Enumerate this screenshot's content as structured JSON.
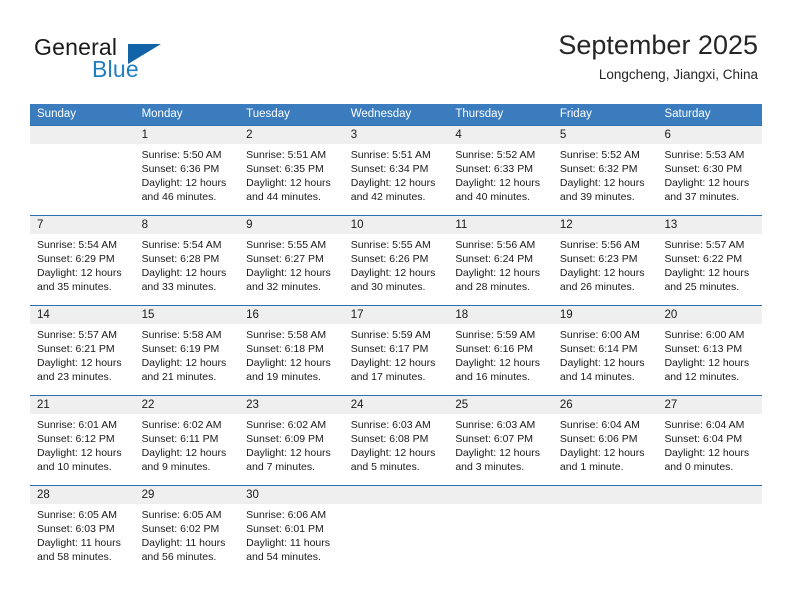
{
  "brand": {
    "word1": "General",
    "word2": "Blue",
    "accent": "#1f7fc4",
    "triangle_color": "#1263a8"
  },
  "header": {
    "title": "September 2025",
    "location": "Longcheng, Jiangxi, China",
    "header_bg": "#3a7cbe",
    "row_divider": "#2f6fad",
    "date_band_bg": "#efefef"
  },
  "weekdays": [
    "Sunday",
    "Monday",
    "Tuesday",
    "Wednesday",
    "Thursday",
    "Friday",
    "Saturday"
  ],
  "weeks": [
    {
      "days": [
        {
          "num": "",
          "l1": "",
          "l2": "",
          "l3": "",
          "l4": ""
        },
        {
          "num": "1",
          "l1": "Sunrise: 5:50 AM",
          "l2": "Sunset: 6:36 PM",
          "l3": "Daylight: 12 hours",
          "l4": "and 46 minutes."
        },
        {
          "num": "2",
          "l1": "Sunrise: 5:51 AM",
          "l2": "Sunset: 6:35 PM",
          "l3": "Daylight: 12 hours",
          "l4": "and 44 minutes."
        },
        {
          "num": "3",
          "l1": "Sunrise: 5:51 AM",
          "l2": "Sunset: 6:34 PM",
          "l3": "Daylight: 12 hours",
          "l4": "and 42 minutes."
        },
        {
          "num": "4",
          "l1": "Sunrise: 5:52 AM",
          "l2": "Sunset: 6:33 PM",
          "l3": "Daylight: 12 hours",
          "l4": "and 40 minutes."
        },
        {
          "num": "5",
          "l1": "Sunrise: 5:52 AM",
          "l2": "Sunset: 6:32 PM",
          "l3": "Daylight: 12 hours",
          "l4": "and 39 minutes."
        },
        {
          "num": "6",
          "l1": "Sunrise: 5:53 AM",
          "l2": "Sunset: 6:30 PM",
          "l3": "Daylight: 12 hours",
          "l4": "and 37 minutes."
        }
      ]
    },
    {
      "days": [
        {
          "num": "7",
          "l1": "Sunrise: 5:54 AM",
          "l2": "Sunset: 6:29 PM",
          "l3": "Daylight: 12 hours",
          "l4": "and 35 minutes."
        },
        {
          "num": "8",
          "l1": "Sunrise: 5:54 AM",
          "l2": "Sunset: 6:28 PM",
          "l3": "Daylight: 12 hours",
          "l4": "and 33 minutes."
        },
        {
          "num": "9",
          "l1": "Sunrise: 5:55 AM",
          "l2": "Sunset: 6:27 PM",
          "l3": "Daylight: 12 hours",
          "l4": "and 32 minutes."
        },
        {
          "num": "10",
          "l1": "Sunrise: 5:55 AM",
          "l2": "Sunset: 6:26 PM",
          "l3": "Daylight: 12 hours",
          "l4": "and 30 minutes."
        },
        {
          "num": "11",
          "l1": "Sunrise: 5:56 AM",
          "l2": "Sunset: 6:24 PM",
          "l3": "Daylight: 12 hours",
          "l4": "and 28 minutes."
        },
        {
          "num": "12",
          "l1": "Sunrise: 5:56 AM",
          "l2": "Sunset: 6:23 PM",
          "l3": "Daylight: 12 hours",
          "l4": "and 26 minutes."
        },
        {
          "num": "13",
          "l1": "Sunrise: 5:57 AM",
          "l2": "Sunset: 6:22 PM",
          "l3": "Daylight: 12 hours",
          "l4": "and 25 minutes."
        }
      ]
    },
    {
      "days": [
        {
          "num": "14",
          "l1": "Sunrise: 5:57 AM",
          "l2": "Sunset: 6:21 PM",
          "l3": "Daylight: 12 hours",
          "l4": "and 23 minutes."
        },
        {
          "num": "15",
          "l1": "Sunrise: 5:58 AM",
          "l2": "Sunset: 6:19 PM",
          "l3": "Daylight: 12 hours",
          "l4": "and 21 minutes."
        },
        {
          "num": "16",
          "l1": "Sunrise: 5:58 AM",
          "l2": "Sunset: 6:18 PM",
          "l3": "Daylight: 12 hours",
          "l4": "and 19 minutes."
        },
        {
          "num": "17",
          "l1": "Sunrise: 5:59 AM",
          "l2": "Sunset: 6:17 PM",
          "l3": "Daylight: 12 hours",
          "l4": "and 17 minutes."
        },
        {
          "num": "18",
          "l1": "Sunrise: 5:59 AM",
          "l2": "Sunset: 6:16 PM",
          "l3": "Daylight: 12 hours",
          "l4": "and 16 minutes."
        },
        {
          "num": "19",
          "l1": "Sunrise: 6:00 AM",
          "l2": "Sunset: 6:14 PM",
          "l3": "Daylight: 12 hours",
          "l4": "and 14 minutes."
        },
        {
          "num": "20",
          "l1": "Sunrise: 6:00 AM",
          "l2": "Sunset: 6:13 PM",
          "l3": "Daylight: 12 hours",
          "l4": "and 12 minutes."
        }
      ]
    },
    {
      "days": [
        {
          "num": "21",
          "l1": "Sunrise: 6:01 AM",
          "l2": "Sunset: 6:12 PM",
          "l3": "Daylight: 12 hours",
          "l4": "and 10 minutes."
        },
        {
          "num": "22",
          "l1": "Sunrise: 6:02 AM",
          "l2": "Sunset: 6:11 PM",
          "l3": "Daylight: 12 hours",
          "l4": "and 9 minutes."
        },
        {
          "num": "23",
          "l1": "Sunrise: 6:02 AM",
          "l2": "Sunset: 6:09 PM",
          "l3": "Daylight: 12 hours",
          "l4": "and 7 minutes."
        },
        {
          "num": "24",
          "l1": "Sunrise: 6:03 AM",
          "l2": "Sunset: 6:08 PM",
          "l3": "Daylight: 12 hours",
          "l4": "and 5 minutes."
        },
        {
          "num": "25",
          "l1": "Sunrise: 6:03 AM",
          "l2": "Sunset: 6:07 PM",
          "l3": "Daylight: 12 hours",
          "l4": "and 3 minutes."
        },
        {
          "num": "26",
          "l1": "Sunrise: 6:04 AM",
          "l2": "Sunset: 6:06 PM",
          "l3": "Daylight: 12 hours",
          "l4": "and 1 minute."
        },
        {
          "num": "27",
          "l1": "Sunrise: 6:04 AM",
          "l2": "Sunset: 6:04 PM",
          "l3": "Daylight: 12 hours",
          "l4": "and 0 minutes."
        }
      ]
    },
    {
      "days": [
        {
          "num": "28",
          "l1": "Sunrise: 6:05 AM",
          "l2": "Sunset: 6:03 PM",
          "l3": "Daylight: 11 hours",
          "l4": "and 58 minutes."
        },
        {
          "num": "29",
          "l1": "Sunrise: 6:05 AM",
          "l2": "Sunset: 6:02 PM",
          "l3": "Daylight: 11 hours",
          "l4": "and 56 minutes."
        },
        {
          "num": "30",
          "l1": "Sunrise: 6:06 AM",
          "l2": "Sunset: 6:01 PM",
          "l3": "Daylight: 11 hours",
          "l4": "and 54 minutes."
        },
        {
          "num": "",
          "l1": "",
          "l2": "",
          "l3": "",
          "l4": ""
        },
        {
          "num": "",
          "l1": "",
          "l2": "",
          "l3": "",
          "l4": ""
        },
        {
          "num": "",
          "l1": "",
          "l2": "",
          "l3": "",
          "l4": ""
        },
        {
          "num": "",
          "l1": "",
          "l2": "",
          "l3": "",
          "l4": ""
        }
      ]
    }
  ]
}
